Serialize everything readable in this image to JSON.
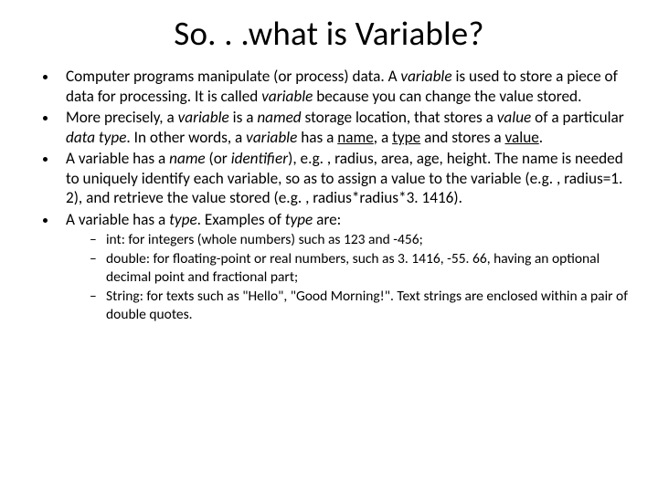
{
  "title": "So. . .what is Variable?",
  "b1_a": "Computer programs manipulate (or process) data. A ",
  "b1_var1": "variable",
  "b1_b": " is used to store a piece of data for processing. It is called ",
  "b1_var2": "variable",
  "b1_c": " because you can change the value stored.",
  "b2_a": "More precisely, a ",
  "b2_var": "variable",
  "b2_b": " is a ",
  "b2_named": "named",
  "b2_c": " storage location, that stores a ",
  "b2_value": "value",
  "b2_d": " of a particular ",
  "b2_dtype": "data type",
  "b2_e": ". In other words, a ",
  "b2_var2": "variable",
  "b2_f": " has a ",
  "b2_name": "name",
  "b2_g": ", a ",
  "b2_type": "type",
  "b2_h": " and stores a ",
  "b2_value2": "value",
  "b2_i": ".",
  "b3_a": "A variable has a ",
  "b3_name": "name",
  "b3_b": " (or ",
  "b3_ident": "identifier",
  "b3_c": "), e.g. , radius, area, age, height. The name is needed to uniquely identify each variable, so as to assign a value to the variable (e.g. , radius=1. 2), and retrieve the value stored (e.g. , radius*radius*3. 1416).",
  "b4_a": "A variable has a ",
  "b4_type": "type",
  "b4_b": ". Examples of ",
  "b4_type2": "type",
  "b4_c": " are:",
  "s1": "int: for integers (whole numbers) such as 123 and -456;",
  "s2": "double: for floating-point or real numbers, such as 3. 1416, -55. 66, having an optional decimal point and fractional part;",
  "s3": "String: for texts such as \"Hello\", \"Good Morning!\". Text strings are enclosed within a pair of double quotes."
}
